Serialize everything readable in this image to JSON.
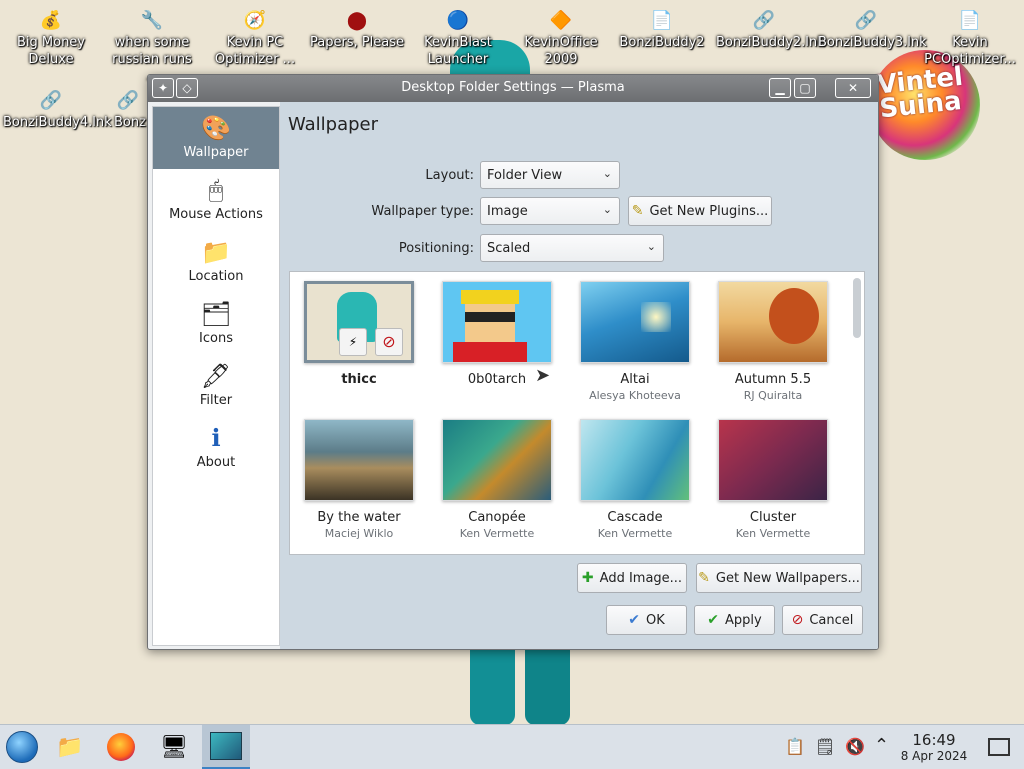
{
  "desktop": {
    "icons": [
      {
        "label": "Big Money Deluxe",
        "glyph": "💰"
      },
      {
        "label": "when some russian runs ...",
        "glyph": "🔧"
      },
      {
        "label": "Kevin PC Optimizer ...",
        "glyph": "🧭"
      },
      {
        "label": "Papers, Please",
        "glyph": "⬤"
      },
      {
        "label": "KevinBlast Launcher",
        "glyph": "🔵"
      },
      {
        "label": "KevinOffice 2009",
        "glyph": "🔶"
      },
      {
        "label": "BonziBuddy2",
        "glyph": "📄"
      },
      {
        "label": "BonziBuddy2.lnk",
        "glyph": "🔗"
      },
      {
        "label": "BonziBuddy3.lnk",
        "glyph": "🔗"
      },
      {
        "label": "Kevin PCOptimizer...",
        "glyph": "📄"
      },
      {
        "label": "BonziBuddy4.lnk",
        "glyph": "🔗"
      },
      {
        "label": "Bonz",
        "glyph": "🔗"
      }
    ],
    "logo_text": "Vintel Suina"
  },
  "window": {
    "title": "Desktop Folder Settings — Plasma",
    "buttons": {
      "minimize": "▁",
      "maximize": "▢",
      "close": "✕"
    }
  },
  "sidebar": {
    "items": [
      {
        "label": "Wallpaper",
        "icon": "wallpaper-icon",
        "glyph": "🎨",
        "active": true
      },
      {
        "label": "Mouse Actions",
        "icon": "mouse-icon",
        "glyph": "🖱",
        "active": false
      },
      {
        "label": "Location",
        "icon": "folder-icon",
        "glyph": "📁",
        "active": false
      },
      {
        "label": "Icons",
        "icon": "icons-icon",
        "glyph": "🗂",
        "active": false
      },
      {
        "label": "Filter",
        "icon": "filter-icon",
        "glyph": "🖋",
        "active": false
      },
      {
        "label": "About",
        "icon": "info-icon",
        "glyph": "ℹ",
        "active": false
      }
    ]
  },
  "main": {
    "heading": "Wallpaper",
    "layout": {
      "label": "Layout:",
      "value": "Folder View"
    },
    "wallpaper_type": {
      "label": "Wallpaper type:",
      "value": "Image",
      "plugins_button": "Get New Plugins..."
    },
    "positioning": {
      "label": "Positioning:",
      "value": "Scaled"
    },
    "wallpapers": [
      {
        "name": "thicc",
        "author": "",
        "selected": true
      },
      {
        "name": "0b0tarch",
        "author": "",
        "selected": false
      },
      {
        "name": "Altai",
        "author": "Alesya Khoteeva",
        "selected": false
      },
      {
        "name": "Autumn 5.5",
        "author": "RJ Quiralta",
        "selected": false
      },
      {
        "name": "By the water",
        "author": "Maciej Wiklo",
        "selected": false
      },
      {
        "name": "Canopée",
        "author": "Ken Vermette",
        "selected": false
      },
      {
        "name": "Cascade",
        "author": "Ken Vermette",
        "selected": false
      },
      {
        "name": "Cluster",
        "author": "Ken Vermette",
        "selected": false
      }
    ],
    "add_image_button": "Add Image...",
    "get_wallpapers_button": "Get New Wallpapers...",
    "ok_button": "OK",
    "apply_button": "Apply",
    "cancel_button": "Cancel"
  },
  "taskbar": {
    "time": "16:49",
    "date": "8 Apr 2024"
  },
  "colors": {
    "sidebar_active": "#708391",
    "content_bg": "#cdd8e1",
    "titlebar": "#7a7c7f"
  }
}
